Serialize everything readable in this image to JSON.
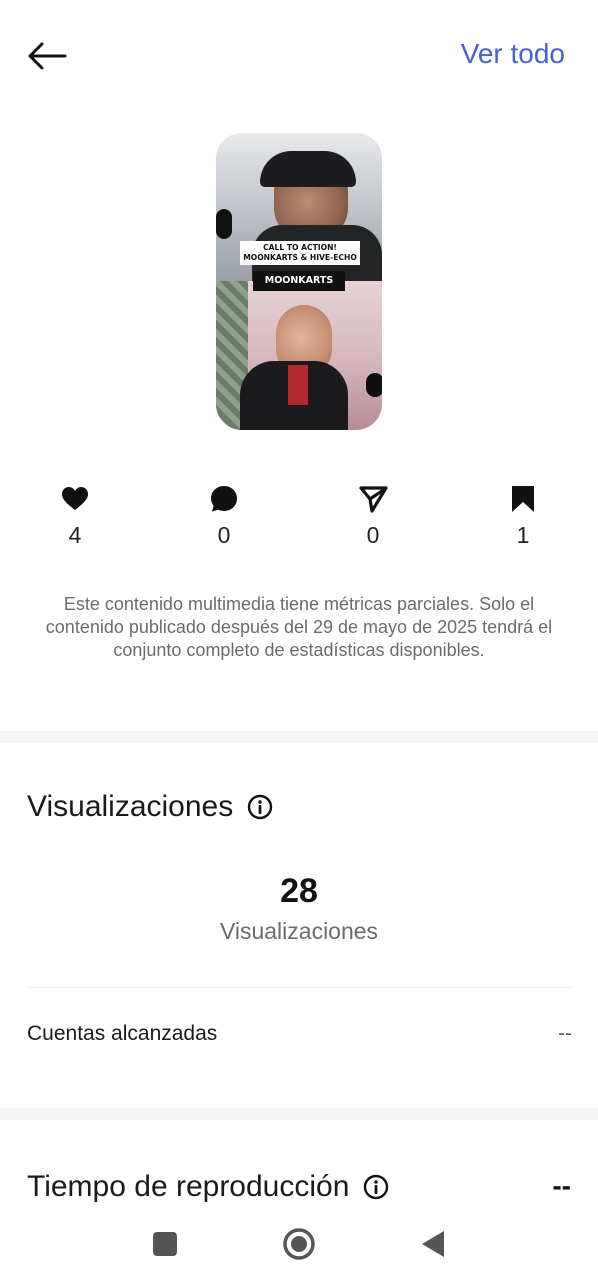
{
  "header": {
    "back_icon": "arrow-left-icon",
    "see_all_label": "Ver todo"
  },
  "thumbnail": {
    "caption_line1": "CALL TO ACTION!",
    "caption_line2": "MOONKARTS & HIVE-ECHO",
    "caption_tag": "MOONKARTS"
  },
  "stats": [
    {
      "icon": "heart-icon",
      "value": "4"
    },
    {
      "icon": "comment-icon",
      "value": "0"
    },
    {
      "icon": "share-icon",
      "value": "0"
    },
    {
      "icon": "bookmark-icon",
      "value": "1"
    }
  ],
  "notice": "Este contenido multimedia tiene métricas parciales. Solo el contenido publicado después del 29 de mayo de 2025 tendrá el conjunto completo de estadísticas disponibles.",
  "views": {
    "title": "Visualizaciones",
    "count": "28",
    "count_label": "Visualizaciones",
    "reached_label": "Cuentas alcanzadas",
    "reached_value": "--"
  },
  "watch_time": {
    "title": "Tiempo de reproducción",
    "value": "--"
  },
  "colors": {
    "accent": "#4a5fd1",
    "text": "#1a1a1a",
    "muted": "#6b6b6b"
  },
  "system_nav": {
    "recents_icon": "square-icon",
    "home_icon": "circle-home-icon",
    "back_icon": "triangle-back-icon"
  }
}
